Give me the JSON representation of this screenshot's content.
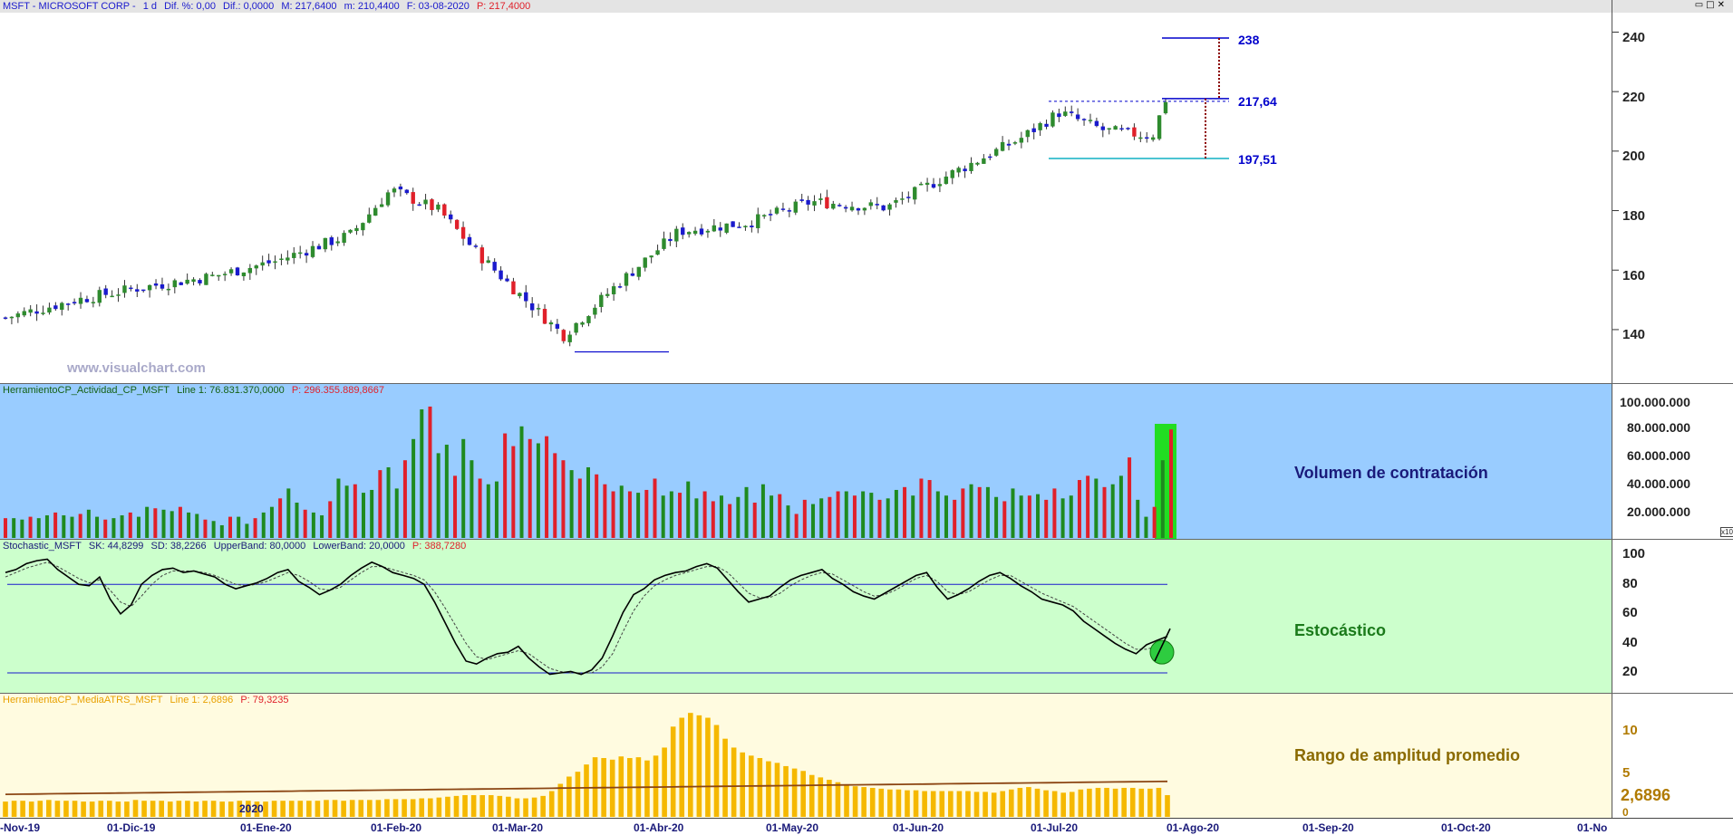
{
  "price_panel": {
    "title_symbol": "MSFT - MICROSOFT CORP -",
    "title_period": "1 d",
    "title_dif_pct": "Dif. %: 0,00",
    "title_dif": "Dif.: 0,0000",
    "title_max": "M: 217,6400",
    "title_min": "m: 210,4400",
    "title_date": "F: 03-08-2020",
    "title_price": "P: 217,4000",
    "watermark": "www.visualchart.com",
    "y_ticks": [
      "240",
      "220",
      "200",
      "180",
      "160",
      "140"
    ],
    "levels": {
      "target": "238",
      "resistance": "217,64",
      "support": "197,51"
    }
  },
  "volume_panel": {
    "title_name": "HerramientoCP_Actividad_CP_MSFT",
    "title_line": "Line 1: 76.831.370,0000",
    "title_p": "P: 296.355.889,8667",
    "y_ticks": [
      "100.000.000",
      "80.000.000",
      "60.000.000",
      "40.000.000",
      "20.000.000"
    ],
    "scale_note": "x10",
    "label": "Volumen de contratación"
  },
  "stoch_panel": {
    "title_name": "Stochastic_MSFT",
    "title_sk": "SK: 44,8299",
    "title_sd": "SD: 38,2266",
    "title_upper": "UpperBand: 80,0000",
    "title_lower": "LowerBand: 20,0000",
    "title_p": "P: 388,7280",
    "y_ticks": [
      "100",
      "80",
      "60",
      "40",
      "20"
    ],
    "label": "Estocástico"
  },
  "atr_panel": {
    "title_name": "HerramientaCP_MediaATRS_MSFT",
    "title_line": "Line 1: 2,6896",
    "title_p": "P: 79,3235",
    "y_ticks": [
      "10",
      "5",
      "0"
    ],
    "current_value": "2,6896",
    "year_marker": "2020",
    "label": "Rango de amplitud promedio"
  },
  "x_axis": {
    "dates": [
      "-Nov-19",
      "01-Dic-19",
      "01-Ene-20",
      "01-Feb-20",
      "01-Mar-20",
      "01-Abr-20",
      "01-May-20",
      "01-Jun-20",
      "01-Jul-20",
      "01-Ago-20",
      "01-Sep-20",
      "01-Oct-20",
      "01-No"
    ]
  },
  "colors": {
    "up_candle": "#2e8b2e",
    "down_candle": "#1a1acd",
    "vol_up": "#1f8a1f",
    "vol_down": "#e0202a",
    "vol_bg": "#99ccff",
    "stoch_bg": "#ccffcc",
    "atr_bg": "#fffbe0",
    "atr_bar": "#f5b800",
    "level_blue": "#0000cc",
    "support_cyan": "#33bbcc"
  },
  "chart_data": [
    {
      "type": "line",
      "title": "MSFT - MICROSOFT CORP - 1 d",
      "series": [
        {
          "name": "",
          "x": [
            "2019-11-15",
            "2019-12-01",
            "2019-12-15",
            "2020-01-01",
            "2020-01-15",
            "2020-02-01",
            "2020-02-10",
            "2020-02-21",
            "2020-03-01",
            "2020-03-10",
            "2020-03-20",
            "2020-04-01",
            "2020-04-15",
            "2020-05-01",
            "2020-05-15",
            "2020-06-01",
            "2020-06-15",
            "2020-07-01",
            "2020-07-10",
            "2020-07-20",
            "2020-07-31",
            "2020-08-03"
          ],
          "values": [
            144,
            150,
            154,
            158,
            163,
            172,
            187,
            180,
            165,
            152,
            138,
            155,
            173,
            176,
            183,
            181,
            192,
            204,
            213,
            207,
            205,
            217.4
          ]
        }
      ],
      "ylim": [
        125,
        247
      ],
      "annotations": [
        {
          "label": "238",
          "value": 238
        },
        {
          "label": "217,64",
          "value": 217.64
        },
        {
          "label": "197,51",
          "value": 197.51
        }
      ]
    },
    {
      "type": "bar",
      "title": "Volumen de contratación",
      "series": [
        {
          "name": "",
          "values": [
            14,
            14,
            13,
            15,
            14,
            16,
            18,
            16,
            15,
            17,
            20,
            15,
            13,
            14,
            16,
            18,
            15,
            22,
            21,
            20,
            19,
            22,
            18,
            17,
            13,
            12,
            9,
            15,
            15,
            10,
            14,
            18,
            22,
            28,
            35,
            25,
            20,
            18,
            16,
            26,
            42,
            37,
            38,
            32,
            34,
            48,
            50,
            35,
            55,
            70,
            91,
            93,
            60,
            66,
            44,
            70,
            55,
            42,
            38,
            40,
            74,
            65,
            79,
            70,
            67,
            72,
            60,
            55,
            48,
            42,
            50,
            45,
            38,
            33,
            37,
            33,
            32,
            34,
            42,
            30,
            33,
            32,
            40,
            28,
            33,
            26,
            30,
            24,
            29,
            36,
            25,
            38,
            30,
            31,
            23,
            17,
            27,
            24,
            28,
            29,
            33,
            33,
            30,
            33,
            32,
            27,
            28,
            34,
            36,
            30,
            42,
            41,
            33,
            30,
            27,
            35,
            38,
            36,
            36,
            29,
            26,
            35,
            30,
            30,
            31,
            27,
            35,
            28,
            30,
            41,
            44,
            42,
            36,
            38,
            44,
            57,
            27,
            15,
            22,
            55,
            76.8
          ]
        }
      ],
      "ylim": [
        0,
        100000000
      ],
      "scale": 1000000
    },
    {
      "type": "line",
      "title": "Estocástico",
      "series": [
        {
          "name": "SK",
          "values": [
            88,
            90,
            94,
            96,
            97,
            90,
            85,
            80,
            79,
            85,
            70,
            60,
            66,
            80,
            86,
            90,
            91,
            88,
            89,
            87,
            85,
            80,
            77,
            79,
            81,
            84,
            88,
            90,
            82,
            78,
            73,
            76,
            80,
            86,
            91,
            95,
            92,
            88,
            86,
            84,
            80,
            68,
            54,
            40,
            28,
            26,
            30,
            33,
            34,
            38,
            30,
            24,
            19,
            20,
            21,
            19,
            22,
            30,
            45,
            61,
            73,
            77,
            83,
            86,
            88,
            89,
            92,
            94,
            91,
            83,
            75,
            68,
            70,
            72,
            78,
            83,
            86,
            88,
            90,
            84,
            80,
            75,
            72,
            70,
            74,
            78,
            82,
            86,
            88,
            78,
            70,
            73,
            77,
            82,
            86,
            88,
            84,
            79,
            75,
            70,
            68,
            66,
            62,
            55,
            50,
            45,
            40,
            36,
            33,
            39,
            42,
            44.8
          ]
        },
        {
          "name": "SD",
          "values": [
            85,
            88,
            91,
            93,
            95,
            92,
            88,
            84,
            81,
            83,
            76,
            68,
            65,
            72,
            80,
            86,
            89,
            89,
            89,
            88,
            86,
            83,
            80,
            79,
            80,
            82,
            85,
            88,
            86,
            82,
            77,
            76,
            78,
            83,
            88,
            92,
            92,
            90,
            88,
            86,
            83,
            75,
            64,
            52,
            40,
            31,
            29,
            31,
            33,
            35,
            33,
            28,
            23,
            21,
            20,
            20,
            20,
            24,
            33,
            48,
            62,
            72,
            79,
            83,
            86,
            88,
            90,
            92,
            92,
            88,
            81,
            74,
            71,
            71,
            74,
            79,
            83,
            86,
            88,
            87,
            83,
            79,
            75,
            72,
            73,
            76,
            80,
            84,
            86,
            82,
            75,
            73,
            75,
            79,
            83,
            86,
            86,
            82,
            78,
            74,
            71,
            68,
            65,
            60,
            55,
            50,
            45,
            40,
            36,
            36,
            38,
            38.2
          ]
        }
      ],
      "bands": {
        "upper": 80,
        "lower": 20
      },
      "ylim": [
        10,
        105
      ]
    },
    {
      "type": "bar",
      "title": "Rango de amplitud promedio",
      "series": [
        {
          "name": "ATR",
          "values": [
            1.9,
            2.0,
            2.0,
            1.9,
            2.0,
            2.1,
            2.0,
            2.0,
            2.0,
            1.9,
            1.9,
            2.0,
            2.0,
            1.9,
            1.9,
            2.1,
            2.0,
            2.0,
            2.0,
            1.9,
            2.0,
            2.0,
            1.9,
            2.0,
            2.0,
            1.9,
            1.9,
            2.0,
            2.0,
            1.9,
            1.9,
            2.0,
            2.0,
            2.0,
            2.0,
            2.0,
            2.0,
            2.1,
            2.1,
            2.0,
            2.1,
            2.1,
            2.1,
            2.1,
            2.2,
            2.2,
            2.2,
            2.2,
            2.3,
            2.3,
            2.4,
            2.5,
            2.6,
            2.7,
            2.7,
            2.7,
            2.7,
            2.6,
            2.5,
            2.3,
            2.3,
            2.4,
            2.6,
            3.2,
            4.1,
            5.0,
            5.6,
            6.5,
            7.4,
            7.3,
            7.1,
            7.5,
            7.3,
            7.4,
            7.0,
            7.6,
            8.6,
            11.2,
            12.3,
            12.9,
            12.6,
            12.3,
            11.4,
            9.7,
            8.6,
            8.0,
            7.6,
            7.3,
            6.9,
            6.7,
            6.3,
            6.0,
            5.7,
            5.2,
            4.9,
            4.6,
            4.3,
            4.0,
            3.8,
            3.7,
            3.6,
            3.5,
            3.4,
            3.4,
            3.3,
            3.3,
            3.2,
            3.2,
            3.2,
            3.2,
            3.2,
            3.2,
            3.1,
            3.1,
            3.0,
            3.2,
            3.4,
            3.6,
            3.7,
            3.5,
            3.3,
            3.2,
            3.0,
            3.1,
            3.4,
            3.5,
            3.6,
            3.6,
            3.5,
            3.6,
            3.6,
            3.5,
            3.5,
            3.6,
            2.7
          ]
        }
      ],
      "ylim": [
        0,
        14
      ]
    }
  ]
}
